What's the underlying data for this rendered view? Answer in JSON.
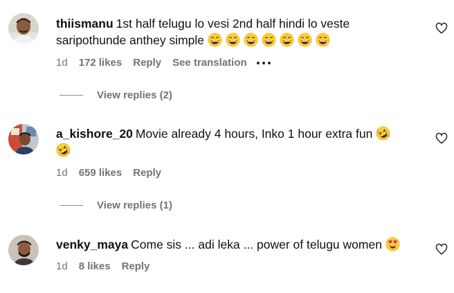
{
  "comments": [
    {
      "username": "thiismanu",
      "text_line1": "1st half telugu lo vesi 2nd half hindi lo veste",
      "text_line2": "saripothunde anthey simple",
      "emojis": [
        "grinning-sweat",
        "grinning-sweat",
        "grinning-sweat",
        "grinning-sweat",
        "grinning-sweat",
        "grinning-sweat",
        "grinning-sweat"
      ],
      "age": "1d",
      "likes": "172 likes",
      "reply_label": "Reply",
      "translate_label": "See translation",
      "view_replies": "View replies (2)",
      "like_icon": "heart-outline-icon"
    },
    {
      "username": "a_kishore_20",
      "text_line1": "Movie already 4 hours, Inko 1 hour extra fun",
      "emojis": [
        "rolling-laughing",
        "rolling-laughing"
      ],
      "age": "1d",
      "likes": "659 likes",
      "reply_label": "Reply",
      "view_replies": "View replies (1)",
      "like_icon": "heart-outline-icon"
    },
    {
      "username": "venky_maya",
      "text_line1": "Come sis ... adi leka ... power of telugu women",
      "emojis": [
        "heart-eyes"
      ],
      "age": "1d",
      "likes": "8 likes",
      "reply_label": "Reply",
      "like_icon": "heart-outline-icon"
    }
  ],
  "colors": {
    "text": "#111111",
    "meta": "#737373",
    "emoji_yellow": "#ffcc33",
    "heart_red": "#e0245e"
  }
}
